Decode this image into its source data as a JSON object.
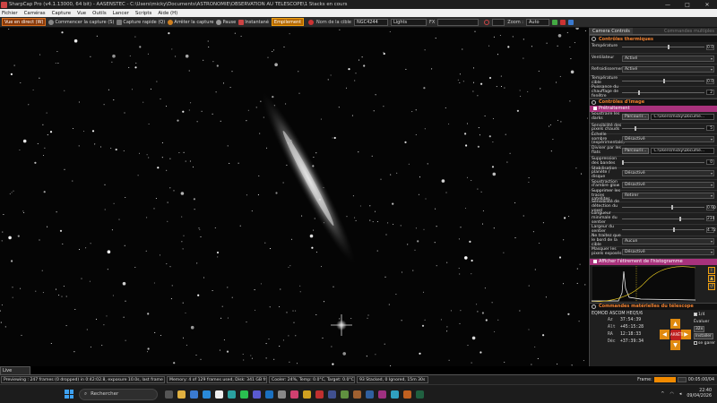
{
  "window": {
    "title": "SharpCap Pro (v4.1.13000, 64 bit) - AASENSTEC - C:\\Users\\micky\\Documents\\ASTRONOMIE\\OBSERVATION AU TELESCOPE\\1 Stacks en cours",
    "controls": [
      "—",
      "□",
      "✕"
    ]
  },
  "menu": [
    "Fichier",
    "Caméras",
    "Capture",
    "Vue",
    "Outils",
    "Lancer",
    "Scripts",
    "Aide (H)"
  ],
  "toolbar": {
    "live_view": "Vue en direct (W)",
    "start_capture": "Commencer la capture (S)",
    "quick_capture": "Capture rapide (Q)",
    "stop_capture": "Arrêter la capture",
    "pause": "Pause",
    "snapshot": "Instantané",
    "stacking": "Empilement",
    "target_label": "Nom de la cible",
    "target_value": "NGC4244",
    "frame_type": "Lights",
    "fx_label": "FX",
    "fx_value": "",
    "zoom_label": "Zoom :",
    "zoom_value": "Auto"
  },
  "panel": {
    "tabs": [
      "Camera Controls",
      "Commandes multiples"
    ],
    "thermal": {
      "title": "Contrôles thermiques",
      "temperature_label": "Température",
      "temperature_value": "0.0",
      "fan_label": "Ventilateur",
      "fan_value": "Activé",
      "cooling_label": "Refroidissement",
      "cooling_value": "Activé",
      "target_temp_label": "Température cible",
      "target_temp_value": "0.0",
      "heater_label": "Puissance du chauffage de fenêtre",
      "heater_value": "2"
    },
    "image": {
      "title": "Contrôles d'image",
      "preprocessing": "Prétraitement",
      "subtract_dark_label": "Soustraire les darks",
      "browse1": "Parcourir...",
      "path1": "C:\\Users\\micky\\Docume...",
      "hot_pixel_label": "Sensibilité des pixels chauds",
      "hot_pixel_value": "5",
      "dark_scale_label": "Échelle sombre (expérimentale)",
      "dark_scale_value": "Désactivé",
      "divide_flat_label": "Diviser par les flats",
      "browse2": "Parcourir...",
      "path2": "C:\\Users\\micky\\Docume...",
      "banding_label": "Suppression des bandes",
      "banding_value": "0",
      "planet_stab_label": "Stabilisation planète / disque",
      "planet_stab_value": "Désactivé",
      "amp_glow_label": "Soustraction d'ambre glow",
      "amp_glow_value": "Désactivé",
      "sat_trails_label": "Supprimer les traces satellites",
      "sat_trails_value": "Retirer",
      "sensitivity_label": "Sensibilité de détection du voxel",
      "sensitivity_value": "0.60",
      "min_length_label": "Longueur minimale du sentier",
      "min_length_value": "234",
      "max_width_label": "Largeur du sentier",
      "max_width_value": "4.72",
      "frames_border_label": "Ne traitez que le bord de la cible",
      "frames_border_value": "Aucun",
      "mask_label": "Masquer les pixels exposés",
      "mask_value": "Désactivé"
    },
    "histogram": {
      "title": "Afficher l'étirement de l'histogramme"
    },
    "telescope": {
      "title": "Commandes matérielles du télescope",
      "mount": "EQMOD ASCOM HEQ5/6",
      "tracking_label": "Tracking",
      "az_label": "Az",
      "az_value": "37:54:39",
      "alt_label": "Alt",
      "alt_value": "+45:15:28",
      "ra_label": "RA",
      "ra_value": "12:18:33",
      "dec_label": "Déc",
      "dec_value": "+37:39:34",
      "center_label": "ARRÊTI",
      "rate_label": "Évaluer",
      "rate_value": "32x",
      "install": "Installer",
      "park": "se garer",
      "flip": "1/4"
    }
  },
  "live_stacking_tab": "Live Stacking",
  "status": {
    "previewing": "Previewing : 247 frames (0 dropped) in 0:42:02.8, exposure 10.0s, last frame 10.0s",
    "memory": "Memory: 4 of 129 frames used, Disk: 341 GB free",
    "cooler": "Cooler: 24%, Temp: 0.0°C, Target: 0.0°C",
    "stacked": "93 Stacked, 0 Ignored, 15m 30s",
    "frames_label": "Frame:",
    "elapsed": "00:05:00/04"
  },
  "taskbar": {
    "search_placeholder": "Rechercher",
    "time": "22:40",
    "date": "09/04/2026"
  },
  "colors": {
    "accent_orange": "#f08a00",
    "section_magenta": "#a8327c",
    "panel_bg": "#1f1f1f"
  }
}
